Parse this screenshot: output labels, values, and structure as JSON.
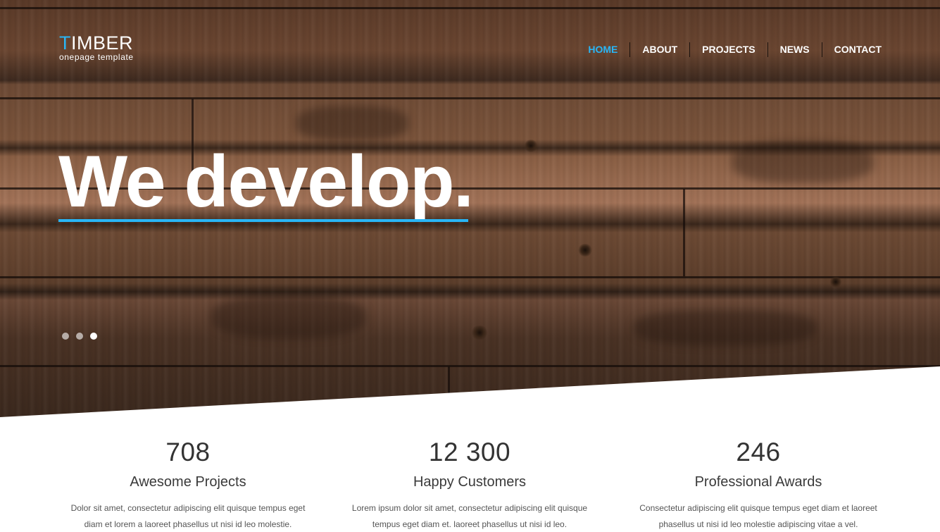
{
  "logo": {
    "first_letter": "T",
    "rest": "IMBER",
    "tagline": "onepage template"
  },
  "nav": {
    "items": [
      {
        "label": "HOME",
        "active": true
      },
      {
        "label": "ABOUT",
        "active": false
      },
      {
        "label": "PROJECTS",
        "active": false
      },
      {
        "label": "NEWS",
        "active": false
      },
      {
        "label": "CONTACT",
        "active": false
      }
    ]
  },
  "hero": {
    "headline": "We develop.",
    "slider": {
      "count": 3,
      "active_index": 2
    }
  },
  "colors": {
    "accent": "#29b6f6",
    "text_dark": "#333333",
    "text_muted": "#555555"
  },
  "stats": [
    {
      "number": "708",
      "label": "Awesome Projects",
      "text_line1": "Dolor sit amet, consectetur adipiscing elit quisque tempus eget",
      "text_line2": "diam et lorem a laoreet phasellus ut nisi id leo molestie."
    },
    {
      "number": "12 300",
      "label": "Happy Customers",
      "text_line1": "Lorem ipsum dolor sit amet, consectetur adipiscing elit quisque",
      "text_line2": "tempus eget diam et. laoreet phasellus ut nisi id leo."
    },
    {
      "number": "246",
      "label": "Professional Awards",
      "text_line1": "Consectetur adipiscing elit quisque tempus eget diam et laoreet",
      "text_line2": "phasellus ut nisi id leo molestie adipiscing vitae a vel."
    }
  ]
}
